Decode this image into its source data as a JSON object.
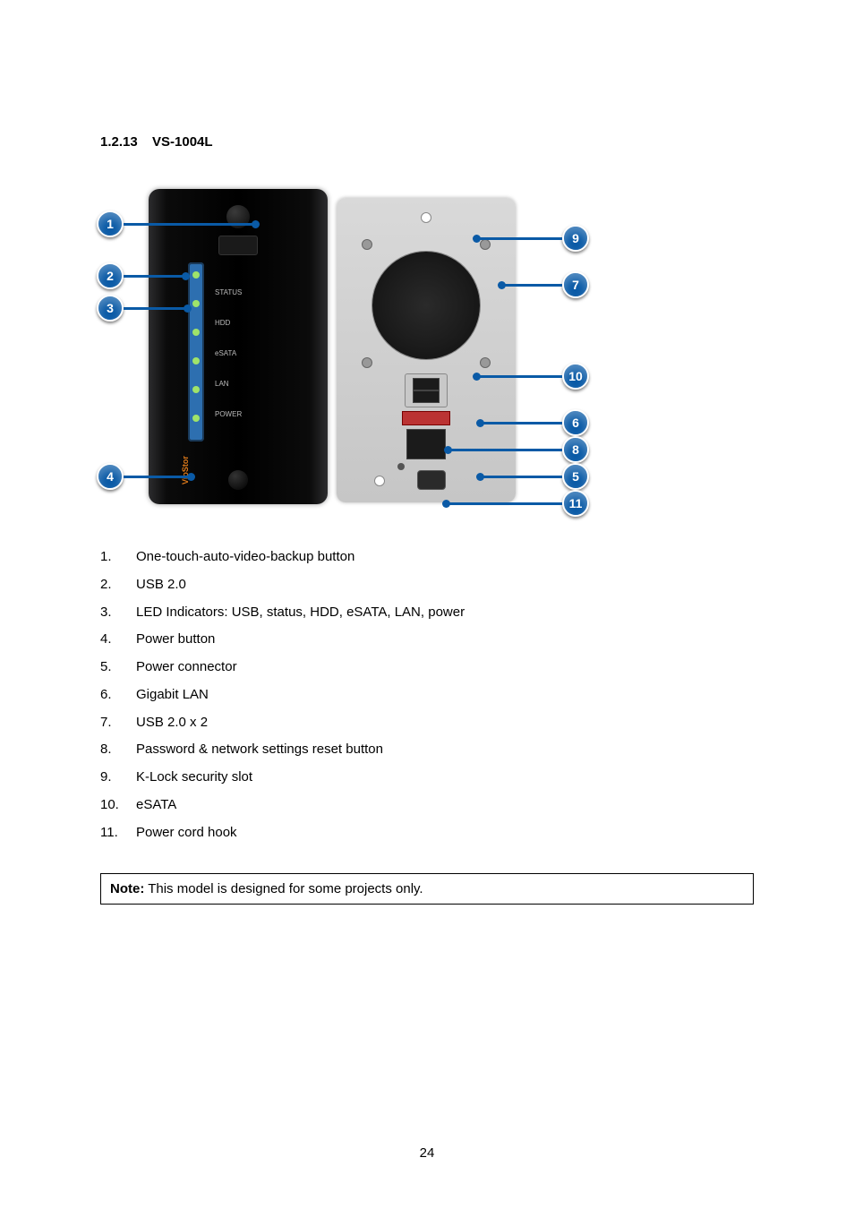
{
  "section": {
    "number": "1.2.13",
    "title": "VS-1004L"
  },
  "device_front_labels": [
    "",
    "STATUS",
    "HDD",
    "eSATA",
    "LAN",
    "POWER"
  ],
  "device_brand": "VioStor",
  "callouts": {
    "c1": "1",
    "c2": "2",
    "c3": "3",
    "c4": "4",
    "c5": "5",
    "c6": "6",
    "c7": "7",
    "c8": "8",
    "c9": "9",
    "c10": "10",
    "c11": "11"
  },
  "legend": [
    {
      "n": "1.",
      "t": "One-touch-auto-video-backup button"
    },
    {
      "n": "2.",
      "t": "USB 2.0"
    },
    {
      "n": "3.",
      "t": "LED Indicators: USB, status, HDD, eSATA, LAN, power"
    },
    {
      "n": "4.",
      "t": "Power button"
    },
    {
      "n": "5.",
      "t": "Power connector"
    },
    {
      "n": "6.",
      "t": "Gigabit LAN"
    },
    {
      "n": "7.",
      "t": "USB 2.0 x 2"
    },
    {
      "n": "8.",
      "t": "Password & network settings reset button"
    },
    {
      "n": "9.",
      "t": "K-Lock security slot"
    },
    {
      "n": "10.",
      "t": "eSATA"
    },
    {
      "n": "11.",
      "t": "Power cord hook"
    }
  ],
  "note": {
    "label": "Note:",
    "text": " This model is designed for some projects only."
  },
  "page_number": "24"
}
